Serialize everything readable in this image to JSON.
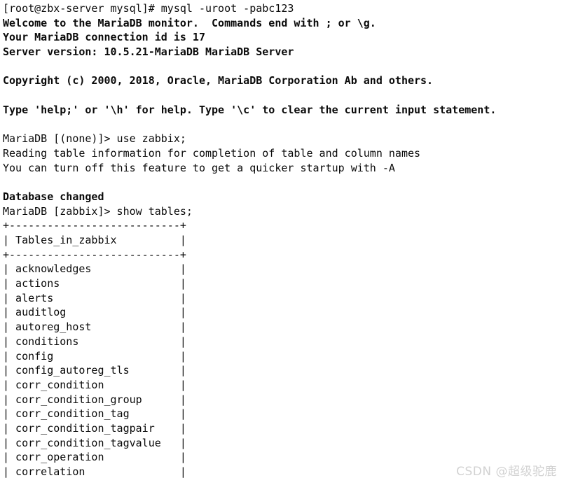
{
  "terminal": {
    "background_color": "#ffffff",
    "foreground_color": "#0a0a0a",
    "prompt_shell": "[root@zbx-server mysql]# ",
    "command": "mysql -uroot -pabc123",
    "lines": [
      {
        "text": "[root@zbx-server mysql]# mysql -uroot -pabc123",
        "bold": false
      },
      {
        "text": "Welcome to the MariaDB monitor.  Commands end with ; or \\g.",
        "bold": true
      },
      {
        "text": "Your MariaDB connection id is 17",
        "bold": true
      },
      {
        "text": "Server version: 10.5.21-MariaDB MariaDB Server",
        "bold": true
      },
      {
        "text": "",
        "bold": false
      },
      {
        "text": "Copyright (c) 2000, 2018, Oracle, MariaDB Corporation Ab and others.",
        "bold": true
      },
      {
        "text": "",
        "bold": false
      },
      {
        "text": "Type 'help;' or '\\h' for help. Type '\\c' to clear the current input statement.",
        "bold": true
      },
      {
        "text": "",
        "bold": false
      },
      {
        "text": "MariaDB [(none)]> use zabbix;",
        "bold": false
      },
      {
        "text": "Reading table information for completion of table and column names",
        "bold": false
      },
      {
        "text": "You can turn off this feature to get a quicker startup with -A",
        "bold": false
      },
      {
        "text": "",
        "bold": false
      },
      {
        "text": "Database changed",
        "bold": true
      },
      {
        "text": "MariaDB [zabbix]> show tables;",
        "bold": false
      },
      {
        "text": "+---------------------------+",
        "bold": false
      },
      {
        "text": "| Tables_in_zabbix          |",
        "bold": false
      },
      {
        "text": "+---------------------------+",
        "bold": false
      },
      {
        "text": "| acknowledges              |",
        "bold": false
      },
      {
        "text": "| actions                   |",
        "bold": false
      },
      {
        "text": "| alerts                    |",
        "bold": false
      },
      {
        "text": "| auditlog                  |",
        "bold": false
      },
      {
        "text": "| autoreg_host              |",
        "bold": false
      },
      {
        "text": "| conditions                |",
        "bold": false
      },
      {
        "text": "| config                    |",
        "bold": false
      },
      {
        "text": "| config_autoreg_tls        |",
        "bold": false
      },
      {
        "text": "| corr_condition            |",
        "bold": false
      },
      {
        "text": "| corr_condition_group      |",
        "bold": false
      },
      {
        "text": "| corr_condition_tag        |",
        "bold": false
      },
      {
        "text": "| corr_condition_tagpair    |",
        "bold": false
      },
      {
        "text": "| corr_condition_tagvalue   |",
        "bold": false
      },
      {
        "text": "| corr_operation            |",
        "bold": false
      },
      {
        "text": "| correlation               |",
        "bold": false
      }
    ],
    "session": {
      "mariadb_welcome": "Welcome to the MariaDB monitor.",
      "connection_id": "17",
      "server_version": "10.5.21-MariaDB MariaDB Server",
      "copyright_years": "2000, 2018",
      "copyright_holder": "Oracle, MariaDB Corporation Ab and others.",
      "database_selected": "zabbix",
      "database_status": "Database changed",
      "table_column_header": "Tables_in_zabbix",
      "table_names": [
        "acknowledges",
        "actions",
        "alerts",
        "auditlog",
        "autoreg_host",
        "conditions",
        "config",
        "config_autoreg_tls",
        "corr_condition",
        "corr_condition_group",
        "corr_condition_tag",
        "corr_condition_tagpair",
        "corr_condition_tagvalue",
        "corr_operation",
        "correlation"
      ]
    }
  },
  "watermark": {
    "text": "CSDN @超级驼鹿",
    "color": "#d2d2d2"
  }
}
